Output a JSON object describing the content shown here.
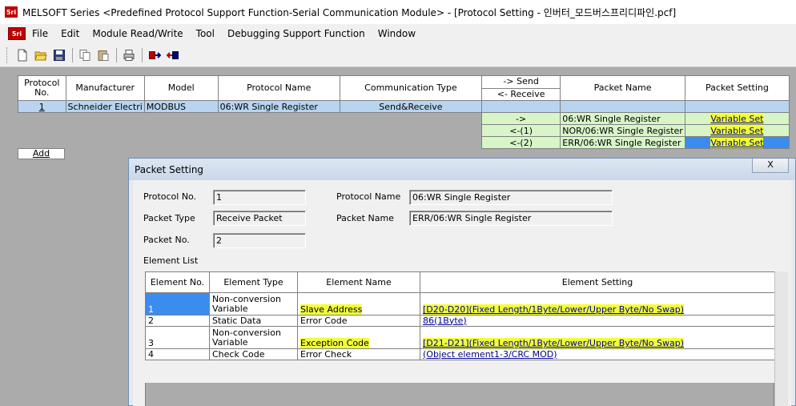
{
  "window": {
    "title": "MELSOFT Series <Predefined Protocol Support Function-Serial Communication Module> - [Protocol Setting - 인버터_모드버스프리디파인.pcf]",
    "app_icon_text": "5ri"
  },
  "menu": {
    "items": [
      "File",
      "Edit",
      "Module Read/Write",
      "Tool",
      "Debugging Support Function",
      "Window"
    ]
  },
  "toolbar": {
    "icons": [
      "new-icon",
      "open-icon",
      "save-icon",
      "copy-icon",
      "paste-icon",
      "print-icon",
      "read-icon",
      "write-icon"
    ]
  },
  "protocol_grid": {
    "headers": {
      "protocol_no": "Protocol No.",
      "manufacturer": "Manufacturer",
      "model": "Model",
      "protocol_name": "Protocol Name",
      "comm_type": "Communication Type",
      "send": "-> Send",
      "receive": "<- Receive",
      "packet_name": "Packet Name",
      "packet_setting": "Packet Setting"
    },
    "row": {
      "protocol_no": "1",
      "manufacturer": "Schneider Electri",
      "model": "MODBUS",
      "protocol_name": "06:WR Single Register",
      "comm_type": "Send&Receive"
    },
    "packets": [
      {
        "dir": "->",
        "name": "06:WR Single Register",
        "setting": "Variable Set"
      },
      {
        "dir": "<-(1)",
        "name": "NOR/06:WR Single Register",
        "setting": "Variable Set"
      },
      {
        "dir": "<-(2)",
        "name": "ERR/06:WR Single Register",
        "setting": "Variable Set"
      }
    ],
    "add_label": "Add"
  },
  "dialog": {
    "title": "Packet Setting",
    "close_label": "X",
    "fields": {
      "protocol_no_label": "Protocol No.",
      "protocol_no": "1",
      "protocol_name_label": "Protocol Name",
      "protocol_name": "06:WR Single Register",
      "packet_type_label": "Packet Type",
      "packet_type": "Receive Packet",
      "packet_name_label": "Packet Name",
      "packet_name": "ERR/06:WR Single Register",
      "packet_no_label": "Packet No.",
      "packet_no": "2"
    },
    "element_list_label": "Element List",
    "element_headers": {
      "no": "Element No.",
      "type": "Element Type",
      "name": "Element Name",
      "setting": "Element Setting"
    },
    "elements": [
      {
        "no": "1",
        "type_line1": "Non-conversion",
        "type_line2": "Variable",
        "name": "Slave Address",
        "setting": "[D20-D20](Fixed Length/1Byte/Lower/Upper Byte/No Swap)"
      },
      {
        "no": "2",
        "type_line1": "Static Data",
        "type_line2": "",
        "name": "Error Code",
        "setting": "86(1Byte)"
      },
      {
        "no": "3",
        "type_line1": "Non-conversion",
        "type_line2": "Variable",
        "name": "Exception Code",
        "setting": "[D21-D21](Fixed Length/1Byte/Lower/Upper Byte/No Swap)"
      },
      {
        "no": "4",
        "type_line1": "Check Code",
        "type_line2": "",
        "name": "Error Check",
        "setting": "(Object element1-3/CRC MOD)"
      }
    ]
  },
  "colors": {
    "highlight": "#f2ff3a",
    "selection_blue": "#3c8cf0",
    "row_select": "#b8d4f0",
    "packet_green": "#d8f5c8"
  }
}
